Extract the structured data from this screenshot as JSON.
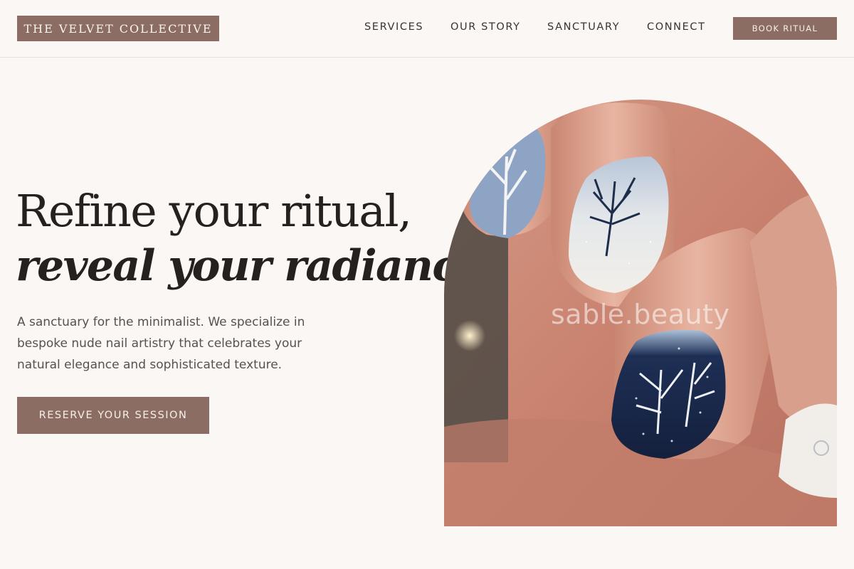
{
  "header": {
    "logo": "THE VELVET COLLECTIVE",
    "nav": [
      "SERVICES",
      "OUR STORY",
      "SANCTUARY",
      "CONNECT"
    ],
    "cta_label": "BOOK RITUAL"
  },
  "hero": {
    "headline_line1": "Refine your ritual,",
    "headline_line2": "reveal your radiance.",
    "description": "A sanctuary for the minimalist. We specialize in bespoke nude nail artistry that celebrates your natural elegance and sophisticated texture.",
    "cta_label": "RESERVE YOUR SESSION",
    "image_watermark": "sable.beauty"
  },
  "colors": {
    "background": "#faf7f4",
    "accent": "#8c6d63",
    "text": "#26211f",
    "muted_text": "#5a504c"
  }
}
